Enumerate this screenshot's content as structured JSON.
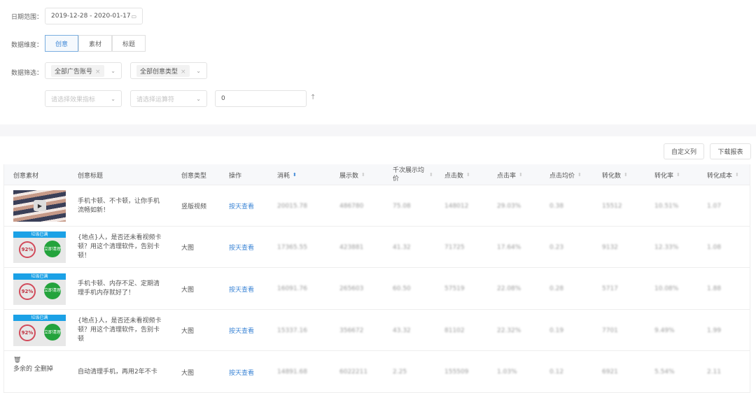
{
  "filters": {
    "date_label": "日期范围：",
    "date_value": "2019-12-28 - 2020-01-17",
    "dim_label": "数据维度：",
    "dims": [
      "创意",
      "素材",
      "标题"
    ],
    "filter_label": "数据筛选：",
    "account_tag": "全部广告账号",
    "type_tag": "全部创意类型",
    "metric_placeholder": "请选择效果指标",
    "compare_placeholder": "请选择运算符",
    "value": "0"
  },
  "toolbar": {
    "custom_columns": "自定义列",
    "download": "下载报表"
  },
  "table": {
    "headers": [
      "创意素材",
      "创意标题",
      "创意类型",
      "操作",
      "消耗",
      "展示数",
      "千次展示均价",
      "点击数",
      "点击率",
      "点击均价",
      "转化数",
      "转化率",
      "转化成本"
    ],
    "rows": [
      {
        "thumb": "video",
        "title": "手机卡顿、不卡顿，让你手机流畅如新！",
        "type": "竖版视频",
        "action": "按天查看",
        "values": [
          "20015.78",
          "486780",
          "75.08",
          "148012",
          "29.03%",
          "0.38",
          "15512",
          "10.51%",
          "1.07"
        ]
      },
      {
        "thumb": "clean",
        "title": "{地点}人，是否还未看视频卡顿？用这个清理软件，告别卡顿！",
        "type": "大图",
        "action": "按天查看",
        "values": [
          "17365.55",
          "423881",
          "41.32",
          "71725",
          "17.64%",
          "0.23",
          "9132",
          "12.33%",
          "1.08"
        ]
      },
      {
        "thumb": "clean",
        "title": "手机卡顿、内存不足、定期清理手机内存就好了！",
        "type": "大图",
        "action": "按天查看",
        "values": [
          "16091.76",
          "265603",
          "60.50",
          "57519",
          "22.08%",
          "0.28",
          "5717",
          "10.08%",
          "1.88"
        ]
      },
      {
        "thumb": "clean",
        "title": "{地点}人，是否还未看视频卡顿？用这个清理软件，告别卡顿",
        "type": "大图",
        "action": "按天查看",
        "values": [
          "15337.16",
          "356672",
          "43.32",
          "81102",
          "22.32%",
          "0.19",
          "7701",
          "9.49%",
          "1.99"
        ]
      },
      {
        "thumb": "delete",
        "title": "自动清理手机，再用2年不卡",
        "type": "大图",
        "action": "按天查看",
        "values": [
          "14891.68",
          "6022211",
          "2.25",
          "155509",
          "1.03%",
          "0.12",
          "6921",
          "5.54%",
          "2.11"
        ]
      }
    ]
  },
  "thumb_text": {
    "banner": "垃圾已满",
    "pct": "92%",
    "go": "立即清理",
    "del": "多余的 全删掉"
  }
}
